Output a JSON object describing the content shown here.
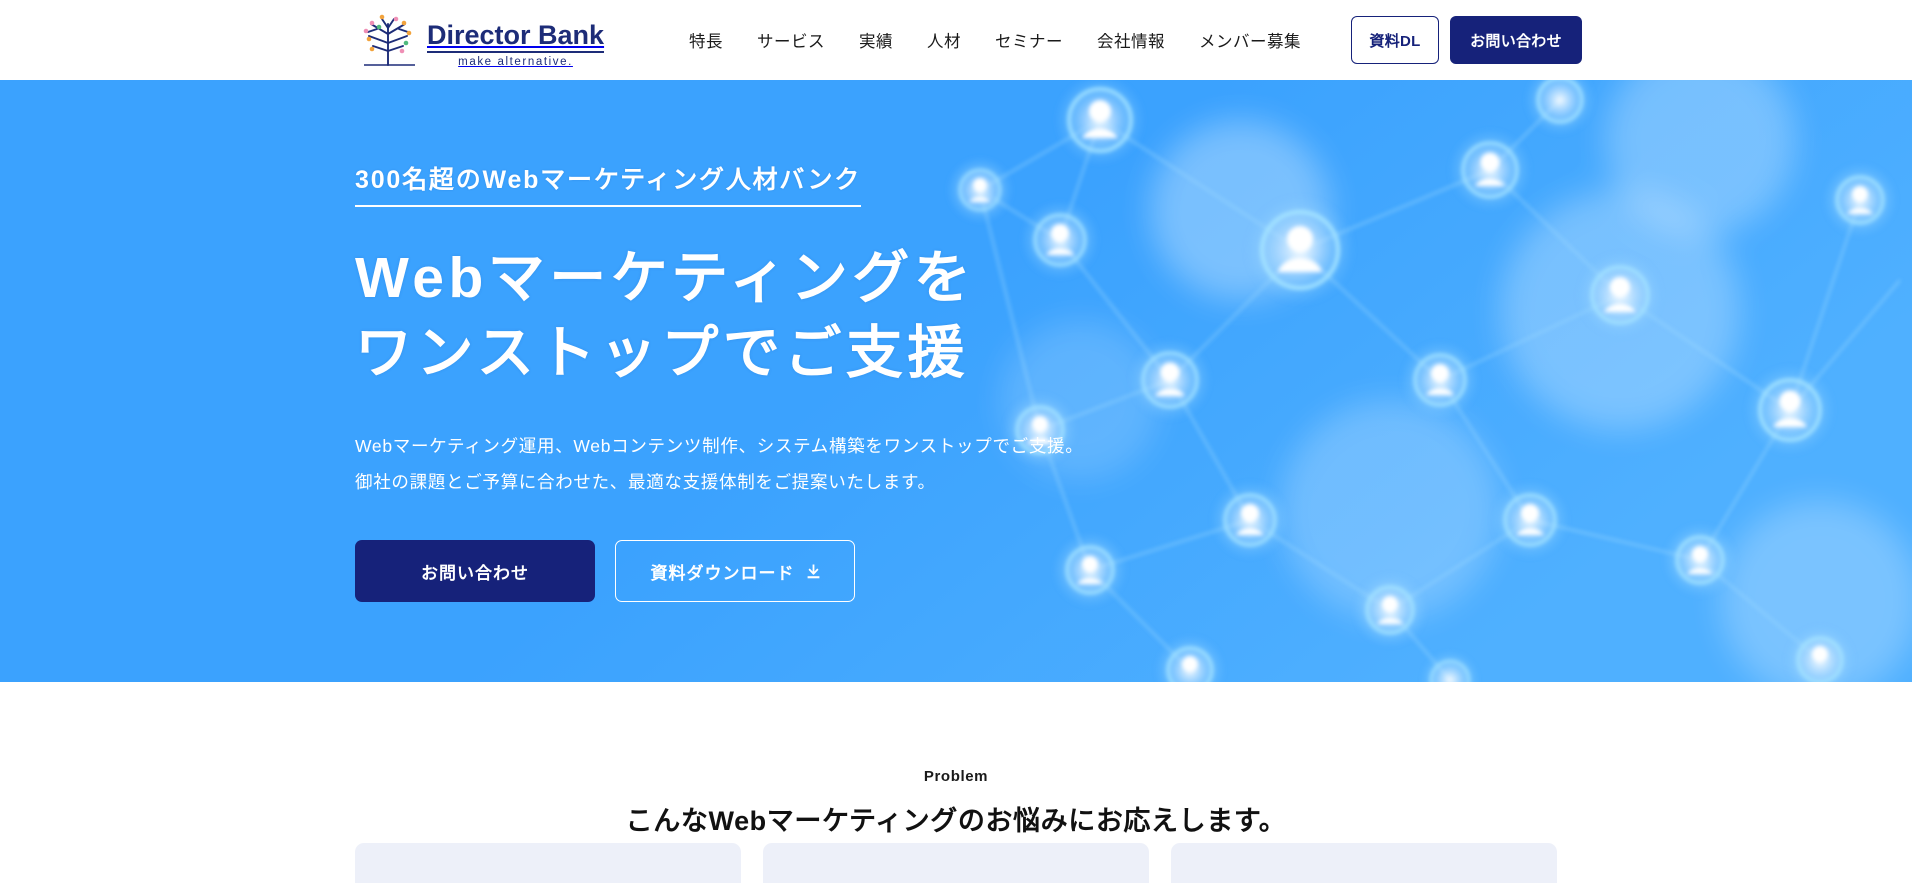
{
  "header": {
    "logo": {
      "name": "Director Bank",
      "tagline": "make alternative.",
      "icon": "tree-logo-icon"
    },
    "nav": [
      {
        "label": "特長"
      },
      {
        "label": "サービス"
      },
      {
        "label": "実績"
      },
      {
        "label": "人材"
      },
      {
        "label": "セミナー"
      },
      {
        "label": "会社情報"
      },
      {
        "label": "メンバー募集"
      }
    ],
    "download_button": "資料DL",
    "contact_button": "お問い合わせ"
  },
  "hero": {
    "tagline": "300名超のWebマーケティング人材バンク",
    "title_line1": "Webマーケティングを",
    "title_line2": "ワンストップでご支援",
    "desc_line1": "Webマーケティング運用、Webコンテンツ制作、システム構築をワンストップでご支援。",
    "desc_line2": "御社の課題とご予算に合わせた、最適な支援体制をご提案いたします。",
    "primary_button": "お問い合わせ",
    "outline_button": "資料ダウンロード",
    "outline_button_icon": "download-icon",
    "background": "network-people-illustration"
  },
  "problem": {
    "label": "Problem",
    "title": "こんなWebマーケティングのお悩みにお応えします。",
    "cards": [
      {
        "id": "card-1"
      },
      {
        "id": "card-2"
      },
      {
        "id": "card-3"
      }
    ]
  },
  "colors": {
    "hero_blue": "#3ba2fe",
    "navy": "#16227a",
    "logo_navy": "#1d2c78",
    "card_bg": "#edf0f9",
    "white": "#ffffff",
    "text_dark": "#111111"
  }
}
